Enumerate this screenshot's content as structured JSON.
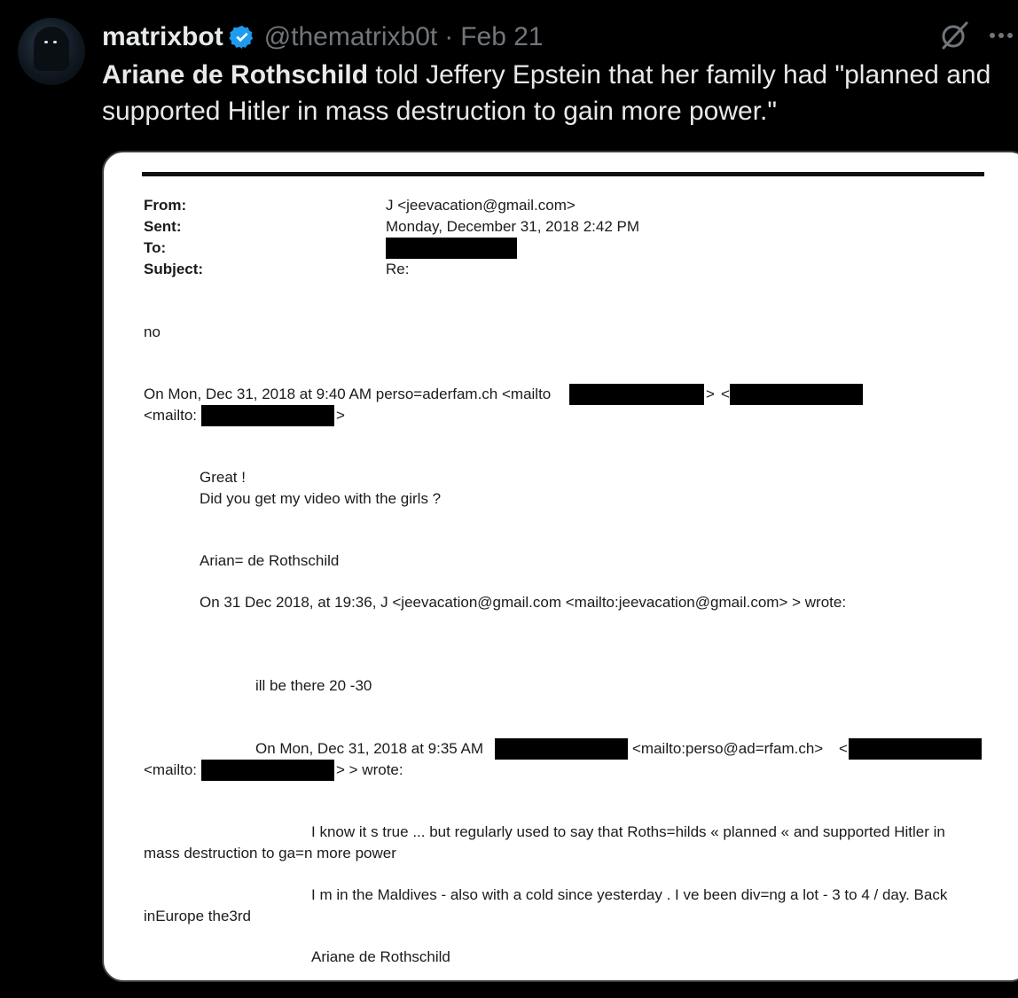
{
  "tweet": {
    "display_name": "matrixbot",
    "handle": "@thematrixb0t",
    "separator": "·",
    "date": "Feb 21",
    "text_bold": "Ariane de Rothschild",
    "text_rest": " told Jeffery Epstein that her family had \"planned and supported Hitler in mass destruction to gain more power.\""
  },
  "email": {
    "from_label": "From:",
    "sent_label": "Sent:",
    "to_label": "To:",
    "subject_label": "Subject:",
    "from_value": "J <jeevacation@gmail.com>",
    "sent_value": "Monday, December 31, 2018 2:42 PM",
    "subject_value": "Re:",
    "reply": "no",
    "quote1_line1_a": "On Mon, Dec 31, 2018 at 9:40 AM perso=aderfam.ch <mailto",
    "quote1_line1_b": ">",
    "quote1_line1_c": "<",
    "quote1_line2_a": "<mailto:",
    "quote1_line2_b": ">",
    "great": "Great !",
    "video": "Did you get my video with the girls ?",
    "sig1": "Arian= de Rothschild",
    "quote2": "On 31 Dec 2018, at 19:36, J <jeevacation@gmail.com <mailto:jeevacation@gmail.com> > wrote:",
    "there": "ill be there 20 -30",
    "quote3_a": "On Mon, Dec 31, 2018 at 9:35 AM",
    "quote3_b": "<mailto:perso@ad=rfam.ch>",
    "quote3_c": "<",
    "quote3_line2_a": "<mailto:",
    "quote3_line2_b": "> > wrote:",
    "para1_line1": "I know it s true ... but regularly used to say that Roths=hilds « planned « and supported Hitler in",
    "para1_line2": "mass destruction to ga=n more power",
    "para2_line1": "I m in the Maldives - also with a cold since yesterday . I ve been div=ng a lot - 3 to 4 / day. Back",
    "para2_line2": "inEurope the3rd",
    "sig2": "Ariane de Rothschild"
  },
  "icons": {
    "verified": "verified-badge-icon",
    "grok": "grok-icon",
    "more": "more-icon"
  },
  "colors": {
    "background": "#000000",
    "text": "#e7e9ea",
    "muted": "#71767b",
    "verified": "#1d9bf0"
  }
}
